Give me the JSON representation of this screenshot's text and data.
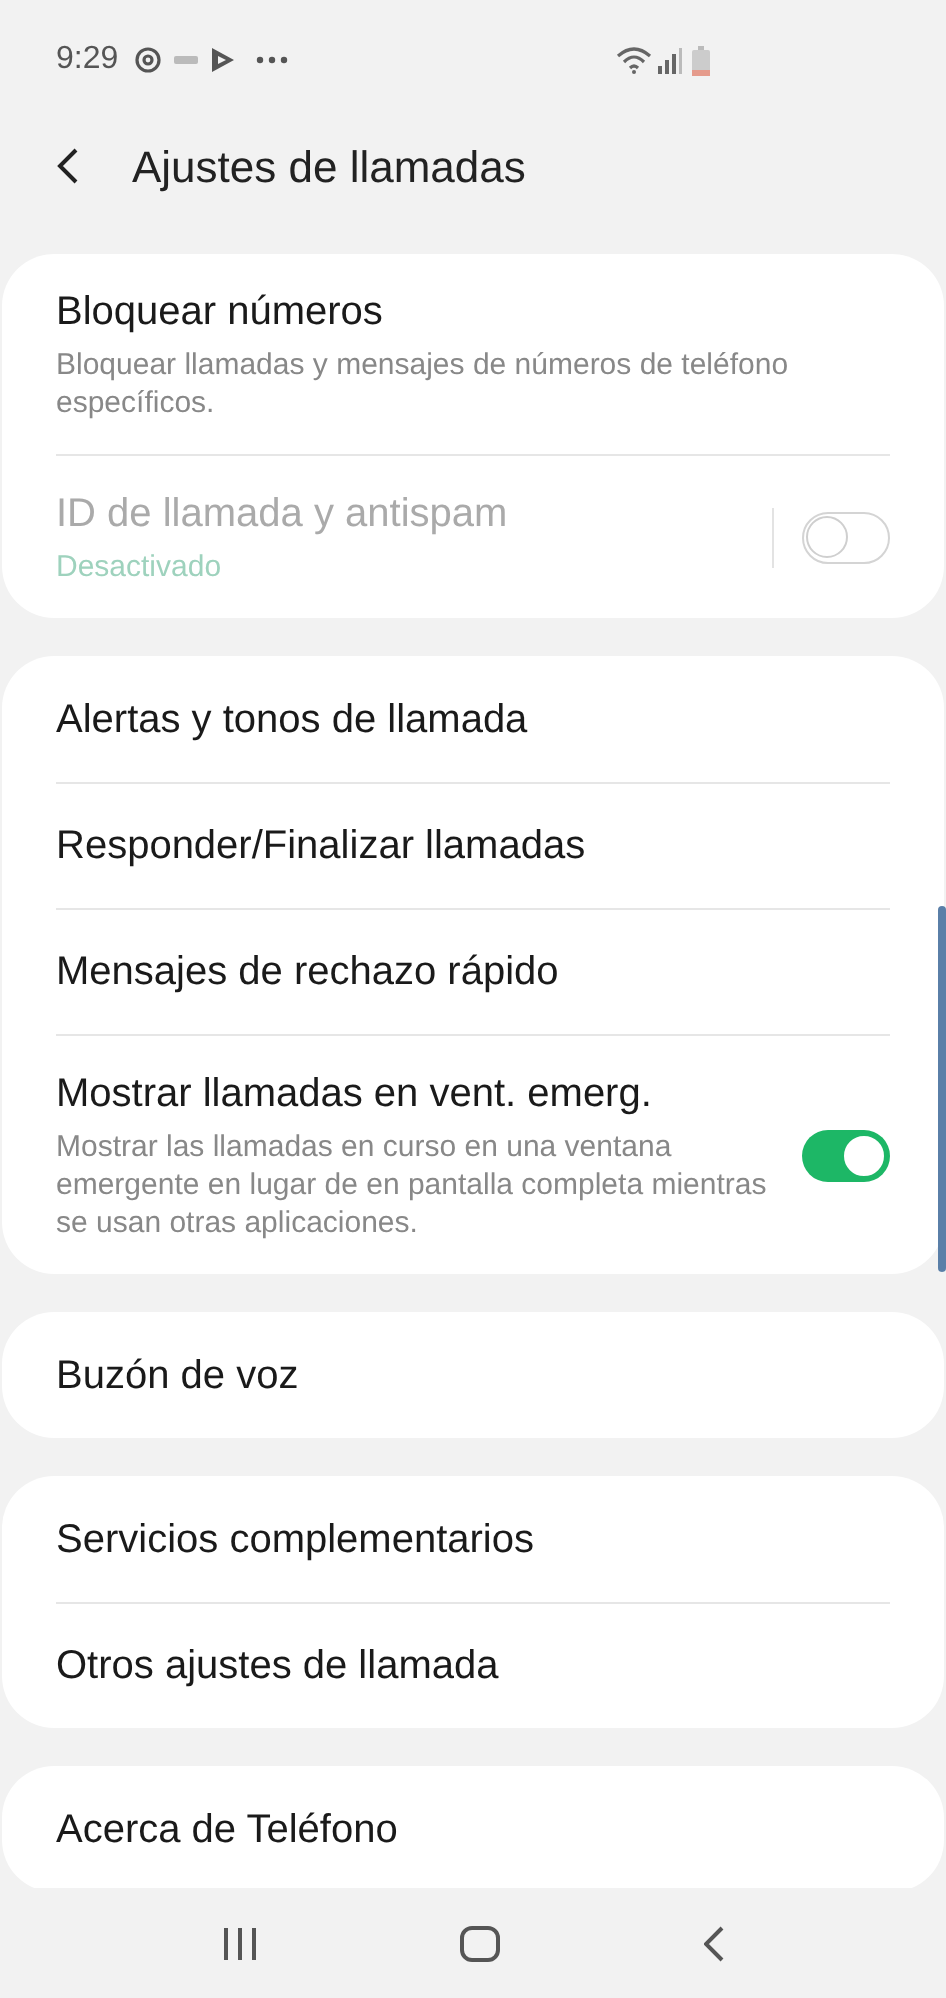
{
  "status_bar": {
    "time": "9:29"
  },
  "header": {
    "title": "Ajustes de llamadas"
  },
  "cards": [
    {
      "items": [
        {
          "kind": "link",
          "title": "Bloquear números",
          "subtitle": "Bloquear llamadas y mensajes de números de teléfono específicos.",
          "disabled": false
        },
        {
          "kind": "toggle",
          "title": "ID de llamada y antispam",
          "status": "Desactivado",
          "disabled": true,
          "on": false
        }
      ]
    },
    {
      "items": [
        {
          "kind": "link",
          "title": "Alertas y tonos de llamada",
          "disabled": false
        },
        {
          "kind": "link",
          "title": "Responder/Finalizar llamadas",
          "disabled": false
        },
        {
          "kind": "link",
          "title": "Mensajes de rechazo rápido",
          "disabled": false
        },
        {
          "kind": "toggle",
          "title": "Mostrar llamadas en vent. emerg.",
          "subtitle": "Mostrar las llamadas en curso en una ventana emergente en lugar de en pantalla completa mientras se usan otras aplicaciones.",
          "disabled": false,
          "on": true
        }
      ]
    },
    {
      "items": [
        {
          "kind": "link",
          "title": "Buzón de voz",
          "disabled": false
        }
      ]
    },
    {
      "items": [
        {
          "kind": "link",
          "title": "Servicios complementarios",
          "disabled": false
        },
        {
          "kind": "link",
          "title": "Otros ajustes de llamada",
          "disabled": false
        }
      ]
    },
    {
      "items": [
        {
          "kind": "link",
          "title": "Acerca de Teléfono",
          "disabled": false
        }
      ]
    }
  ]
}
